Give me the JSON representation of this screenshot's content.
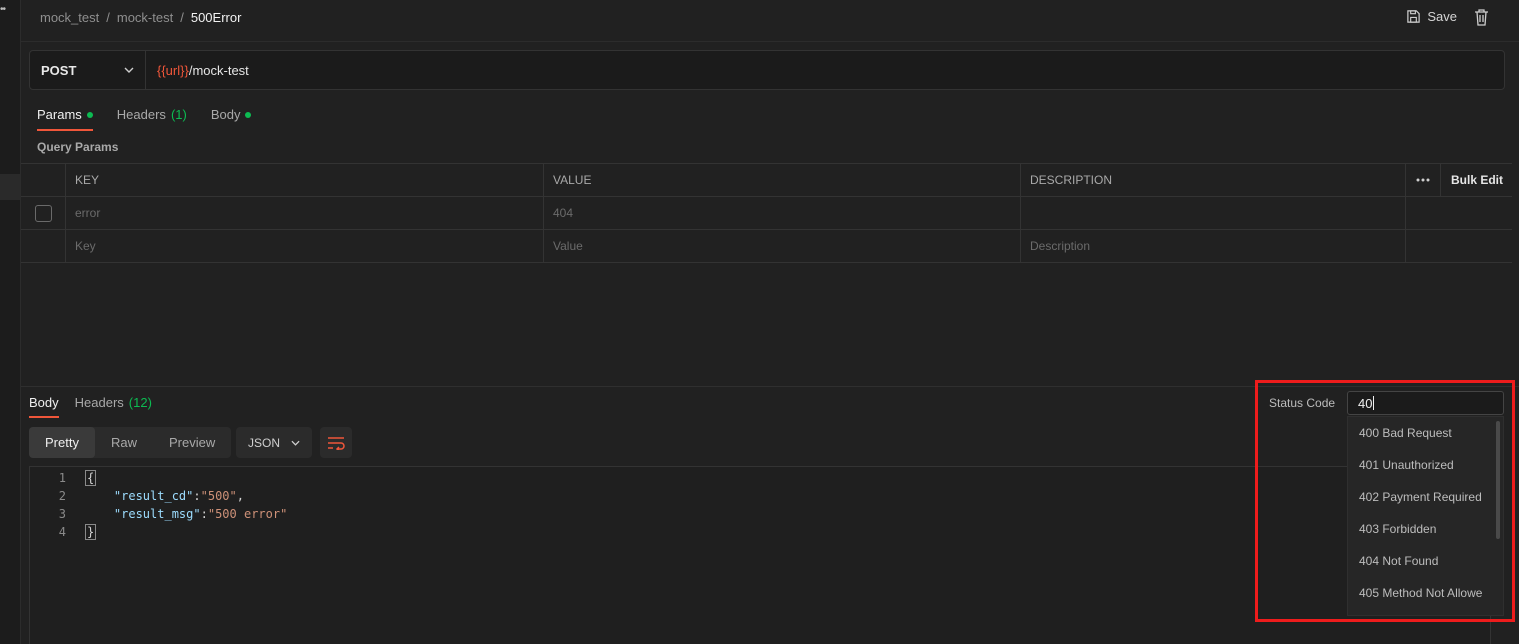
{
  "breadcrumb": {
    "items": [
      "mock_test",
      "mock-test",
      "500Error"
    ],
    "separator": "/"
  },
  "toolbar": {
    "save_label": "Save"
  },
  "request": {
    "method": "POST",
    "url_var": "{{url}}",
    "url_path": "/mock-test"
  },
  "req_tabs": [
    {
      "label": "Params",
      "dot": true,
      "count": ""
    },
    {
      "label": "Headers",
      "dot": false,
      "count": "(1)"
    },
    {
      "label": "Body",
      "dot": true,
      "count": ""
    }
  ],
  "query_params": {
    "title": "Query Params",
    "headers": {
      "key": "KEY",
      "value": "VALUE",
      "description": "DESCRIPTION",
      "bulk_edit": "Bulk Edit"
    },
    "rows": [
      {
        "key": "error",
        "value": "404",
        "description": ""
      }
    ],
    "placeholders": {
      "key": "Key",
      "value": "Value",
      "description": "Description"
    }
  },
  "response": {
    "tabs": [
      {
        "label": "Body",
        "count": ""
      },
      {
        "label": "Headers",
        "count": "(12)"
      }
    ],
    "views": [
      "Pretty",
      "Raw",
      "Preview"
    ],
    "format": "JSON",
    "line_numbers": [
      "1",
      "2",
      "3",
      "4"
    ],
    "body": {
      "open_brace": "{",
      "close_brace": "}",
      "lines": [
        {
          "key": "\"result_cd\"",
          "value": "\"500\"",
          "trail": ","
        },
        {
          "key": "\"result_msg\"",
          "value": "\"500 error\"",
          "trail": ""
        }
      ]
    }
  },
  "status_code": {
    "label": "Status Code",
    "input_value": "40",
    "options": [
      "400 Bad Request",
      "401 Unauthorized",
      "402 Payment Required",
      "403 Forbidden",
      "404 Not Found",
      "405 Method Not Allowe"
    ]
  },
  "colors": {
    "accent": "#f0563a",
    "success": "#0cbb52",
    "highlight": "#ee1c1c"
  }
}
